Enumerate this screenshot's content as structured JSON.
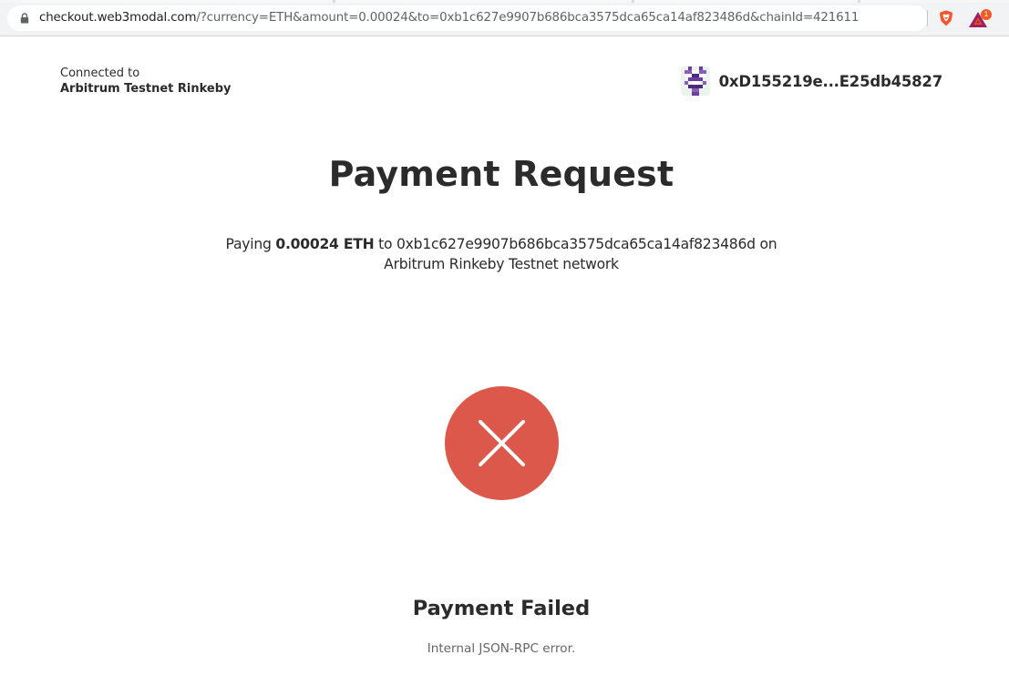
{
  "browser": {
    "url_host": "checkout.web3modal.com",
    "url_rest": "/?currency=ETH&amount=0.00024&to=0xb1c627e9907b686bca3575dca65ca14af823486d&chainId=421611",
    "rewards_badge_count": "1",
    "icons": {
      "lock": "lock-icon",
      "shield": "brave-shield-icon",
      "rewards": "bat-rewards-icon"
    }
  },
  "header": {
    "connected_label": "Connected to",
    "network_name": "Arbitrum Testnet Rinkeby",
    "account_address": "0xD155219e...E25db45827"
  },
  "main": {
    "title": "Payment Request",
    "paying_prefix": "Paying",
    "amount": "0.00024 ETH",
    "to_word": "to",
    "recipient": "0xb1c627e9907b686bca3575dca65ca14af823486d",
    "on_word": "on",
    "network_line": "Arbitrum Rinkeby Testnet network"
  },
  "status": {
    "icon": "error-x-icon",
    "title": "Payment Failed",
    "message": "Internal JSON-RPC error."
  },
  "colors": {
    "error": "#db584a",
    "text": "#2b2b2b",
    "muted": "#666666",
    "brave": "#fb542b",
    "bat": "#9e1f63"
  }
}
